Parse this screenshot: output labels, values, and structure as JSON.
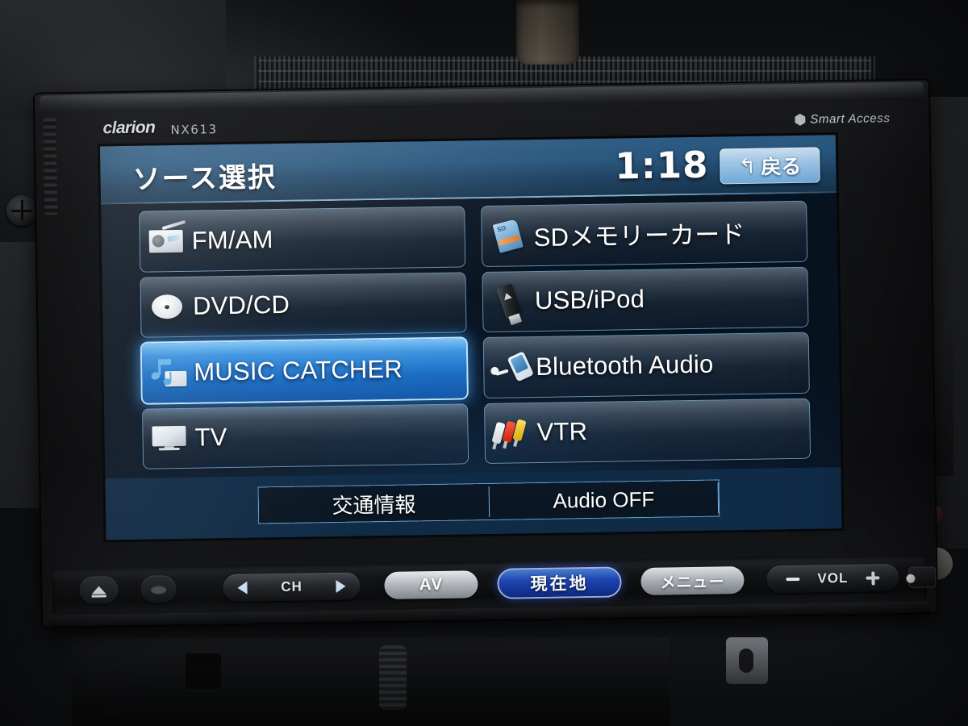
{
  "device": {
    "brand": "clarion",
    "model": "NX613",
    "smart_access_label": "Smart Access",
    "smart_access_icon": "smart-access-logo-icon"
  },
  "screen": {
    "header": {
      "title": "ソース選択",
      "clock": "1:18",
      "back_button": {
        "label": "戻る",
        "icon": "return-arrow-icon"
      }
    },
    "sources": [
      {
        "label": "FM/AM",
        "icon": "radio-icon",
        "selected": false,
        "column": "left"
      },
      {
        "label": "SDメモリーカード",
        "icon": "sd-card-icon",
        "selected": false,
        "column": "right"
      },
      {
        "label": "DVD/CD",
        "icon": "disc-icon",
        "selected": false,
        "column": "left"
      },
      {
        "label": "USB/iPod",
        "icon": "usb-stick-icon",
        "selected": false,
        "column": "right"
      },
      {
        "label": "MUSIC CATCHER",
        "icon": "music-note-card-icon",
        "selected": true,
        "column": "left"
      },
      {
        "label": "Bluetooth Audio",
        "icon": "bluetooth-phone-icon",
        "selected": false,
        "column": "right"
      },
      {
        "label": "TV",
        "icon": "television-icon",
        "selected": false,
        "column": "left"
      },
      {
        "label": "VTR",
        "icon": "rca-plugs-icon",
        "selected": false,
        "column": "right"
      }
    ],
    "bottom_bar": [
      {
        "label": "交通情報"
      },
      {
        "label": "Audio OFF"
      }
    ]
  },
  "hard_buttons": {
    "eject": {
      "icon": "eject-icon"
    },
    "dot": {
      "icon": "oval-indicator-icon"
    },
    "channel": {
      "label": "CH",
      "prev_icon": "left-arrow-icon",
      "next_icon": "right-arrow-icon"
    },
    "av": {
      "label": "AV"
    },
    "current_location": {
      "label": "現在地",
      "illuminated": true
    },
    "menu": {
      "label": "メニュー"
    },
    "volume": {
      "label": "VOL",
      "minus_icon": "minus-icon",
      "plus_icon": "plus-icon"
    },
    "reset": {
      "icon": "reset-square-icon"
    },
    "mic": {
      "icon": "microphone-dot-icon"
    }
  },
  "colors": {
    "accent_blue": "#1a6dc4",
    "selected_glow": "#3c96eb",
    "header_blue": "#27567e",
    "button_border": "#87beeb",
    "now_button_blue": "#1f48b4"
  }
}
